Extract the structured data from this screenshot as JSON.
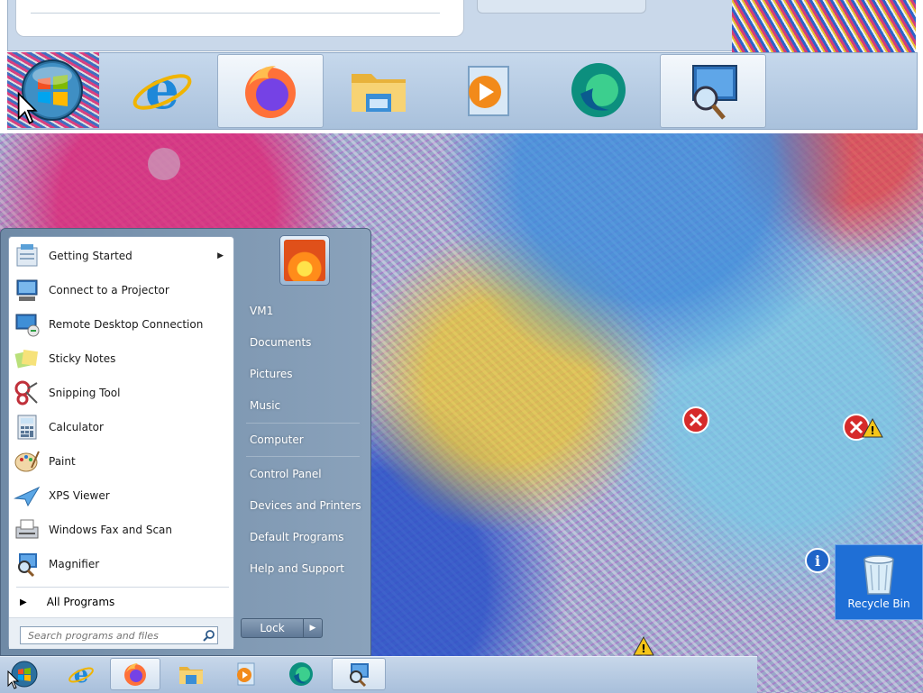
{
  "start_menu": {
    "programs": [
      {
        "label": "Getting Started",
        "icon": "getting-started-icon",
        "has_submenu": true
      },
      {
        "label": "Connect to a Projector",
        "icon": "projector-icon"
      },
      {
        "label": "Remote Desktop Connection",
        "icon": "remote-desktop-icon"
      },
      {
        "label": "Sticky Notes",
        "icon": "sticky-notes-icon"
      },
      {
        "label": "Snipping Tool",
        "icon": "snipping-tool-icon"
      },
      {
        "label": "Calculator",
        "icon": "calculator-icon"
      },
      {
        "label": "Paint",
        "icon": "paint-icon"
      },
      {
        "label": "XPS Viewer",
        "icon": "xps-viewer-icon"
      },
      {
        "label": "Windows Fax and Scan",
        "icon": "fax-scan-icon"
      },
      {
        "label": "Magnifier",
        "icon": "magnifier-icon"
      }
    ],
    "all_programs": "All Programs",
    "search_placeholder": "Search programs and files",
    "right_links": [
      "VM1",
      "Documents",
      "Pictures",
      "Music",
      "Computer",
      "Control Panel",
      "Devices and Printers",
      "Default Programs",
      "Help and Support"
    ],
    "lock_label": "Lock"
  },
  "taskbar": {
    "items": [
      "start-orb-icon",
      "internet-explorer-icon",
      "firefox-icon",
      "file-explorer-icon",
      "media-player-icon",
      "edge-icon",
      "magnifier-icon"
    ],
    "active": [
      "firefox-icon",
      "magnifier-icon"
    ]
  },
  "desktop": {
    "recycle_bin_label": "Recycle Bin"
  }
}
